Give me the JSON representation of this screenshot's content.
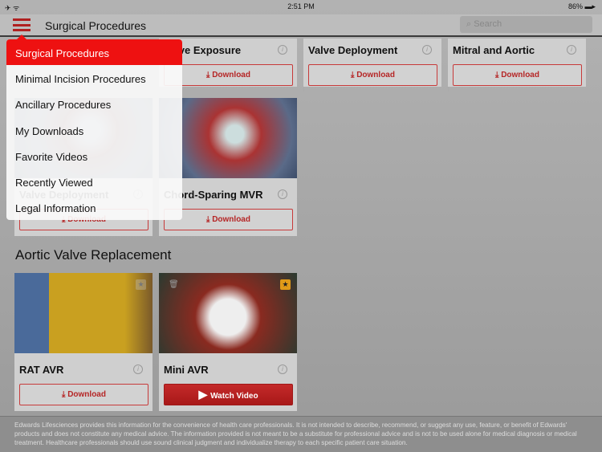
{
  "status": {
    "left": "✈ ᯤ",
    "time": "2:51 PM",
    "battery": "86% ▬▸"
  },
  "nav": {
    "title": "Surgical Procedures",
    "search_placeholder": "Search"
  },
  "row1": [
    {
      "title": "Valve Exposure",
      "button": "Download"
    },
    {
      "title": "Valve Deployment",
      "button": "Download"
    },
    {
      "title": "Mitral and Aortic",
      "button": "Download"
    }
  ],
  "row2": [
    {
      "title": "Valve Deployment",
      "button": "Download"
    },
    {
      "title": "Chord-Sparing MVR",
      "button": "Download"
    }
  ],
  "section": "Aortic Valve Replacement",
  "row3": [
    {
      "title": "RAT AVR",
      "button": "Download",
      "favorite": false
    },
    {
      "title": "Mini AVR",
      "button": "Watch Video",
      "favorite": true
    }
  ],
  "menu": [
    "Surgical Procedures",
    "Minimal Incision Procedures",
    "Ancillary Procedures",
    "My Downloads",
    "Favorite Videos",
    "Recently Viewed",
    "Legal Information"
  ],
  "footer": "Edwards Lifesciences provides this information for the convenience of health care professionals. It is not intended to describe, recommend, or suggest any use, feature, or benefit of Edwards' products and does not constitute any medical advice. The information provided is not meant to be a substitute for professional advice and is not to be used alone for medical diagnosis or medical treatment. Healthcare professionals should use sound clinical judgment and individualize therapy to each specific patient care situation.",
  "colors": {
    "accent": "#ee1111",
    "button_text": "#b52525",
    "favorite": "#e09a18"
  }
}
